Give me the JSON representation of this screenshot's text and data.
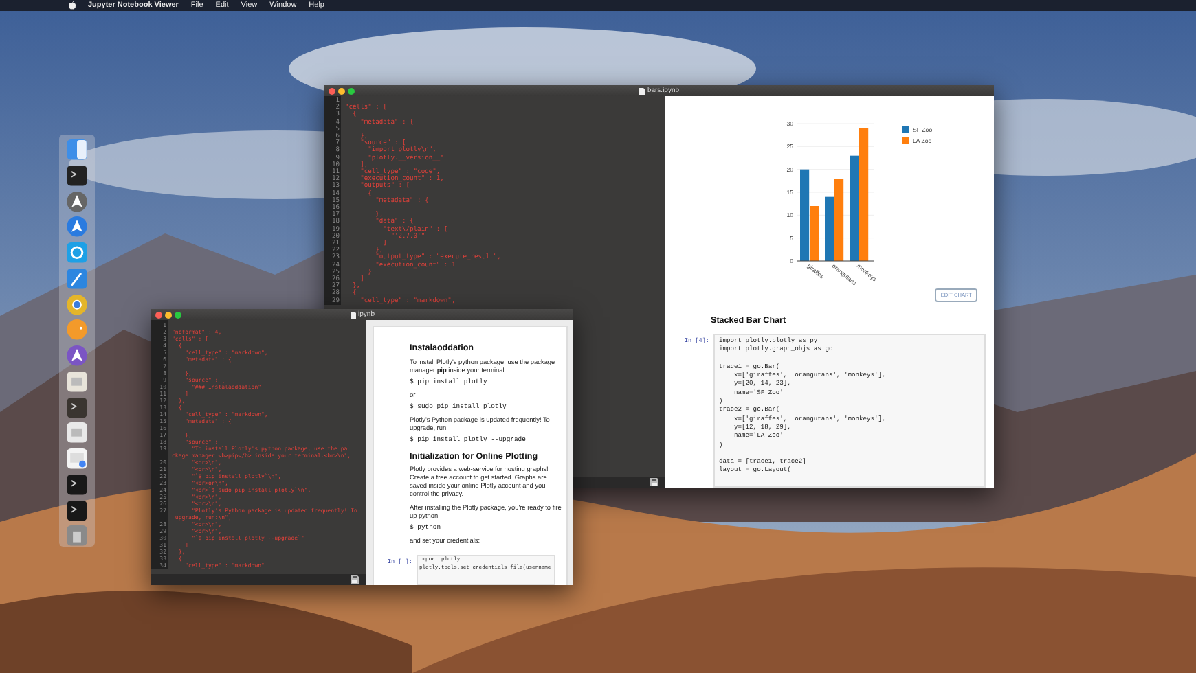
{
  "menu_bar": {
    "app_name": "Jupyter Notebook Viewer",
    "items": [
      "File",
      "Edit",
      "View",
      "Window",
      "Help"
    ]
  },
  "windows": [
    {
      "kind": "chart",
      "title": "bars.ipynb",
      "line_numbers": "1\n2\n3\n4\n5\n6\n7\n8\n9\n10\n11\n12\n13\n14\n15\n16\n17\n18\n19\n20\n21\n22\n23\n24\n25\n26\n27\n28\n29",
      "source": "\n\"cells\" : [\n  {\n    \"metadata\" : {\n\n    },\n    \"source\" : [\n      \"import plotly\\n\",\n      \"plotly.__version__\"\n    ],\n    \"cell_type\" : \"code\",\n    \"execution_count\" : 1,\n    \"outputs\" : [\n      {\n        \"metadata\" : {\n\n        },\n        \"data\" : {\n          \"text\\/plain\" : [\n            \"'2.7.0'\"\n          ]\n        },\n        \"output_type\" : \"execute_result\",\n        \"execution_count\" : 1\n      }\n    ]\n  },\n  {\n    \"cell_type\" : \"markdown\",",
      "preview": {
        "chart_data": {
          "type": "bar",
          "categories": [
            "giraffes",
            "orangutans",
            "monkeys"
          ],
          "series": [
            {
              "name": "SF Zoo",
              "color": "#1f77b4",
              "values": [
                20,
                14,
                23
              ]
            },
            {
              "name": "LA Zoo",
              "color": "#ff7f0e",
              "values": [
                12,
                18,
                29
              ]
            }
          ],
          "ylim": [
            0,
            30
          ],
          "yticks": [
            0,
            5,
            10,
            15,
            20,
            25,
            30
          ],
          "grid": true,
          "legend": true
        },
        "edit_button": "EDIT CHART",
        "heading": "Stacked Bar Chart",
        "cell": {
          "prompt": "In [4]:",
          "code": "import plotly.plotly as py\nimport plotly.graph_objs as go\n\ntrace1 = go.Bar(\n    x=['giraffes', 'orangutans', 'monkeys'],\n    y=[20, 14, 23],\n    name='SF Zoo'\n)\ntrace2 = go.Bar(\n    x=['giraffes', 'orangutans', 'monkeys'],\n    y=[12, 18, 29],\n    name='LA Zoo'\n)\n\ndata = [trace1, trace2]\nlayout = go.Layout("
        }
      }
    },
    {
      "kind": "notes",
      "title": "ipynb",
      "line_numbers": "1\n2\n3\n4\n5\n6\n7\n8\n9\n10\n11\n12\n13\n14\n15\n16\n17\n18\n19\n\n20\n21\n22\n23\n24\n25\n26\n27\n\n28\n29\n30\n31\n32\n33\n34",
      "source": "\n\"nbformat\" : 4,\n\"cells\" : [\n  {\n    \"cell_type\" : \"markdown\",\n    \"metadata\" : {\n\n    },\n    \"source\" : [\n      \"### Instalaoddation\"\n    ]\n  },\n  {\n    \"cell_type\" : \"markdown\",\n    \"metadata\" : {\n\n    },\n    \"source\" : [\n      \"To install Plotly's python package, use the pa\nckage manager <b>pip</b> inside your terminal.<br>\\n\",\n      \"<br>\\n\",\n      \"<br>\\n\",\n      \"`$ pip install plotly`\\n\",\n      \"<br>or\\n\",\n      \"<br>`$ sudo pip install plotly`\\n\",\n      \"<br>\\n\",\n      \"<br>\\n\",\n      \"Plotly's Python package is updated frequently! To\n upgrade, run:\\n\",\n      \"<br>\\n\",\n      \"<br>\\n\",\n      \"`$ pip install plotly --upgrade`\"\n    ]\n  },\n  {\n    \"cell_type\" : \"markdown\"",
      "preview": {
        "blocks": [
          {
            "kind": "heading",
            "text": "Instalaoddation"
          },
          {
            "kind": "text",
            "text": "To install Plotly's python package, use the package manager **pip** inside your terminal."
          },
          {
            "kind": "code",
            "text": "$ pip install plotly"
          },
          {
            "kind": "text",
            "text": "or"
          },
          {
            "kind": "code",
            "text": "$ sudo pip install plotly"
          },
          {
            "kind": "text",
            "text": "Plotly's Python package is updated frequently! To upgrade, run:"
          },
          {
            "kind": "code",
            "text": "$ pip install plotly --upgrade"
          },
          {
            "kind": "heading",
            "text": "Initialization for Online Plotting"
          },
          {
            "kind": "text",
            "text": "Plotly provides a web-service for hosting graphs! Create a free account to get started. Graphs are saved inside your online Plotly account and you control the privacy."
          },
          {
            "kind": "text",
            "text": "After installing the Plotly package, you're ready to fire up python:"
          },
          {
            "kind": "code",
            "text": "$ python"
          },
          {
            "kind": "text",
            "text": "and set your credentials:"
          }
        ],
        "cell": {
          "prompt": "In [ ]:",
          "code": "import plotly\nplotly.tools.set_credentials_file(username"
        }
      }
    }
  ]
}
